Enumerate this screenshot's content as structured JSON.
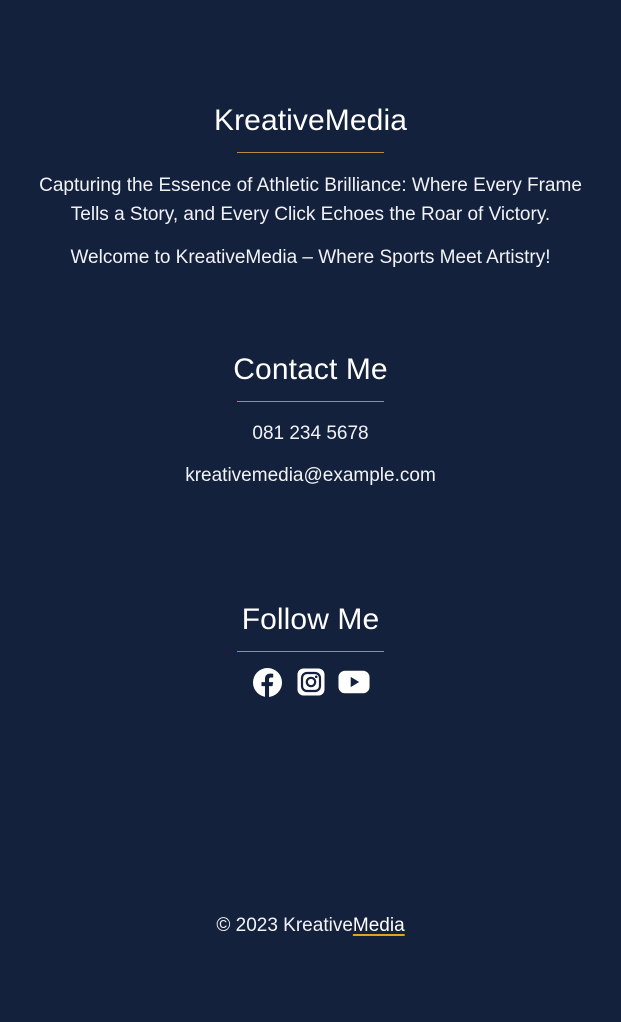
{
  "brand": {
    "title": "KreativeMedia",
    "tagline": "Capturing the Essence of Athletic Brilliance: Where Every Frame Tells a Story, and Every Click Echoes the Roar of Victory.",
    "welcome": "Welcome to KreativeMedia – Where Sports Meet Artistry!"
  },
  "contact": {
    "title": "Contact Me",
    "phone": "081 234 5678",
    "email": "kreativemedia@example.com"
  },
  "follow": {
    "title": "Follow Me",
    "icons": [
      "facebook-icon",
      "instagram-icon",
      "youtube-icon"
    ]
  },
  "footer": {
    "copyright_prefix": "© 2023 Kreative",
    "copyright_link": "Media"
  },
  "colors": {
    "background": "#14213d",
    "accent": "#b8893e",
    "link_underline": "#e2a21f",
    "text": "#ffffff"
  }
}
